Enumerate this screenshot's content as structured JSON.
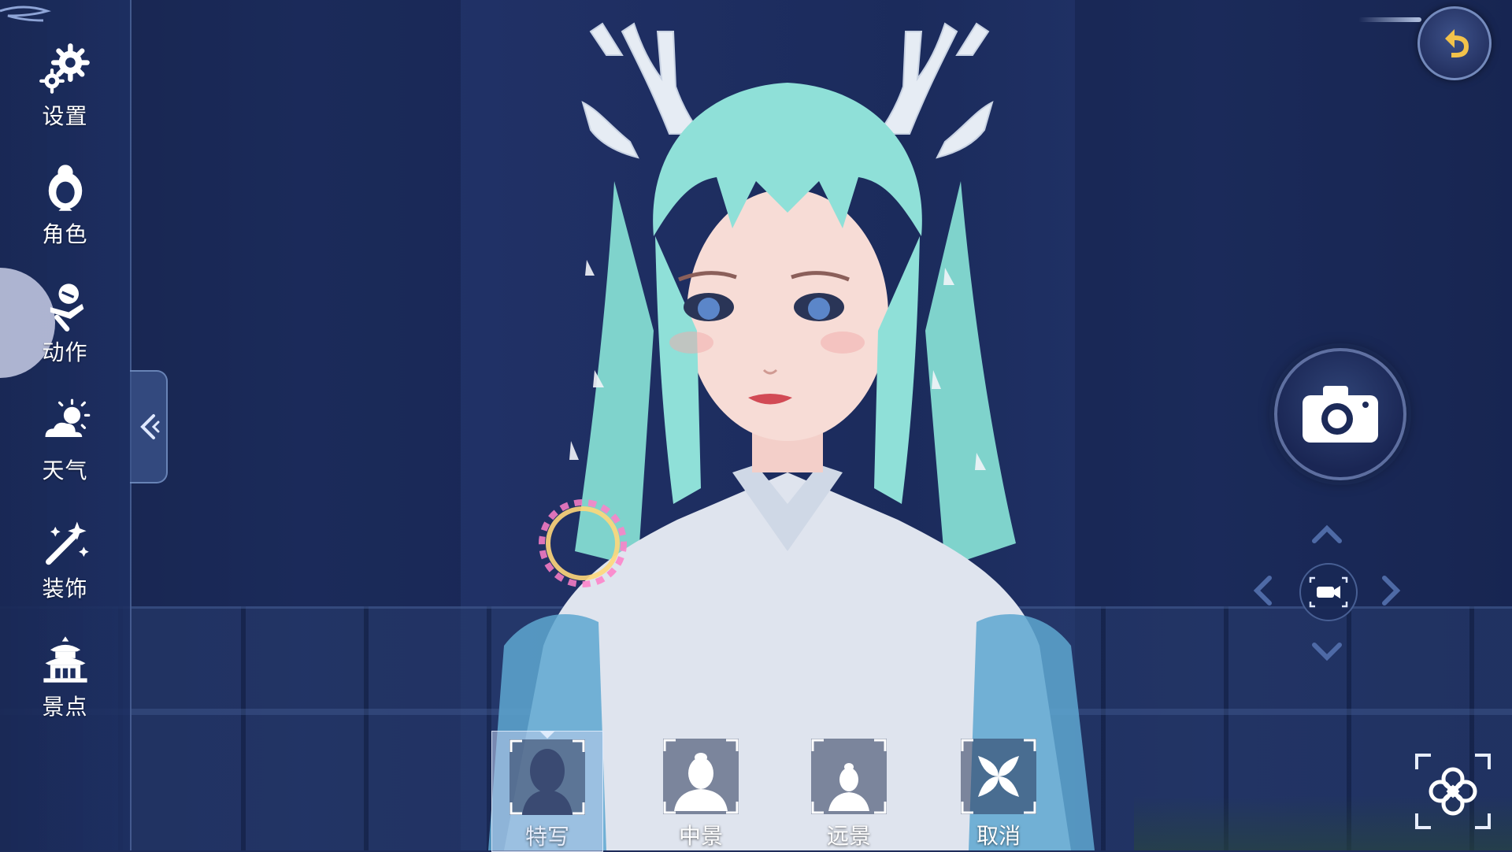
{
  "sidebar": {
    "items": [
      {
        "label": "设置",
        "icon": "gear-icon"
      },
      {
        "label": "角色",
        "icon": "character-icon"
      },
      {
        "label": "动作",
        "icon": "pose-icon"
      },
      {
        "label": "天气",
        "icon": "weather-icon"
      },
      {
        "label": "装饰",
        "icon": "decoration-wand-icon"
      },
      {
        "label": "景点",
        "icon": "pagoda-icon"
      }
    ],
    "active_index": 2
  },
  "camera_shots": {
    "items": [
      {
        "label": "特写",
        "icon": "closeup-portrait-icon"
      },
      {
        "label": "中景",
        "icon": "medium-shot-portrait-icon"
      },
      {
        "label": "远景",
        "icon": "long-shot-portrait-icon"
      },
      {
        "label": "取消",
        "icon": "cancel-x-icon"
      }
    ],
    "selected_index": 0
  },
  "controls": {
    "back": "back-arrow-icon",
    "capture": "camera-icon",
    "video": "video-camera-icon",
    "fullscreen": "focus-frame-icon"
  },
  "colors": {
    "sidebar_bg": "#1c2e60",
    "accent_gold": "#f2c24a",
    "hair": "#8fe0d8",
    "ring_pink": "#ff7fc8"
  }
}
